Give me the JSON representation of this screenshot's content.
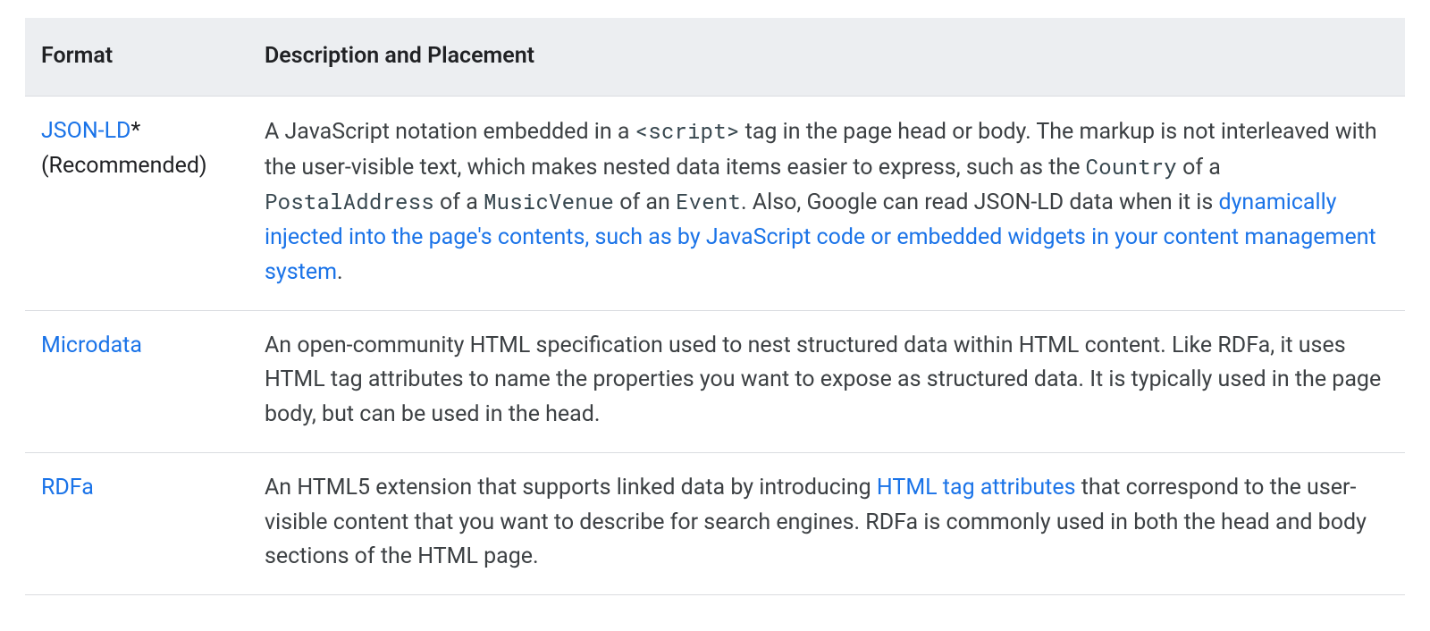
{
  "table": {
    "headers": {
      "format": "Format",
      "description": "Description and Placement"
    },
    "rows": [
      {
        "format": {
          "link_text": "JSON-LD",
          "suffix": "*",
          "note": "(Recommended)"
        },
        "description": {
          "pre_code": "A JavaScript notation embedded in a ",
          "code1": "<script>",
          "mid1": " tag in the page head or body. The markup is not interleaved with the user-visible text, which makes nested data items easier to express, such as the ",
          "code2": "Country",
          "mid2": " of a ",
          "code3": "PostalAddress",
          "mid3": " of a ",
          "code4": "MusicVenue",
          "mid4": " of an ",
          "code5": "Event",
          "mid5": ". Also, Google can read JSON-LD data when it is ",
          "link_text": "dynamically injected into the page's contents, such as by JavaScript code or embedded widgets in your content management system",
          "post": "."
        }
      },
      {
        "format": {
          "link_text": "Microdata"
        },
        "description": {
          "text": "An open-community HTML specification used to nest structured data within HTML content. Like RDFa, it uses HTML tag attributes to name the properties you want to expose as structured data. It is typically used in the page body, but can be used in the head."
        }
      },
      {
        "format": {
          "link_text": "RDFa"
        },
        "description": {
          "pre_link": "An HTML5 extension that supports linked data by introducing ",
          "link_text": "HTML tag attributes",
          "post_link": " that correspond to the user-visible content that you want to describe for search engines. RDFa is commonly used in both the head and body sections of the HTML page."
        }
      }
    ]
  }
}
